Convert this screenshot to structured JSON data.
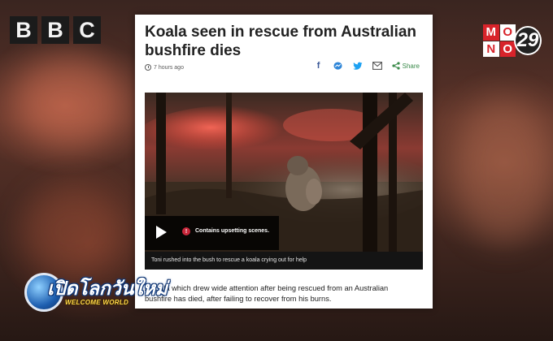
{
  "broadcast": {
    "bbc_letters": [
      "B",
      "B",
      "C"
    ],
    "channel_logo": {
      "cells": [
        "M",
        "O",
        "N",
        "O"
      ],
      "number": "29"
    },
    "show_logo": {
      "title": "เปิดโลกวันใหม่",
      "subtitle": "WELCOME WORLD"
    }
  },
  "article": {
    "headline": "Koala seen in rescue from Australian bushfire dies",
    "time_ago": "7 hours ago",
    "share_icons": [
      "facebook-icon",
      "messenger-icon",
      "twitter-icon",
      "email-icon"
    ],
    "share_label": "Share",
    "video": {
      "warning": "Contains upsetting scenes.",
      "caption": "Toni rushed into the bush to rescue a koala crying out for help"
    },
    "body": "A koala which drew wide attention after being rescued from an Australian bushfire has died, after failing to recover from his burns."
  },
  "colors": {
    "bbc_box": "#1b1b1b",
    "mono_red": "#d8232a",
    "share_green": "#3a8a4a",
    "facebook_blue": "#3b5998",
    "messenger_blue": "#2f86d8",
    "twitter_blue": "#1da1f2"
  }
}
